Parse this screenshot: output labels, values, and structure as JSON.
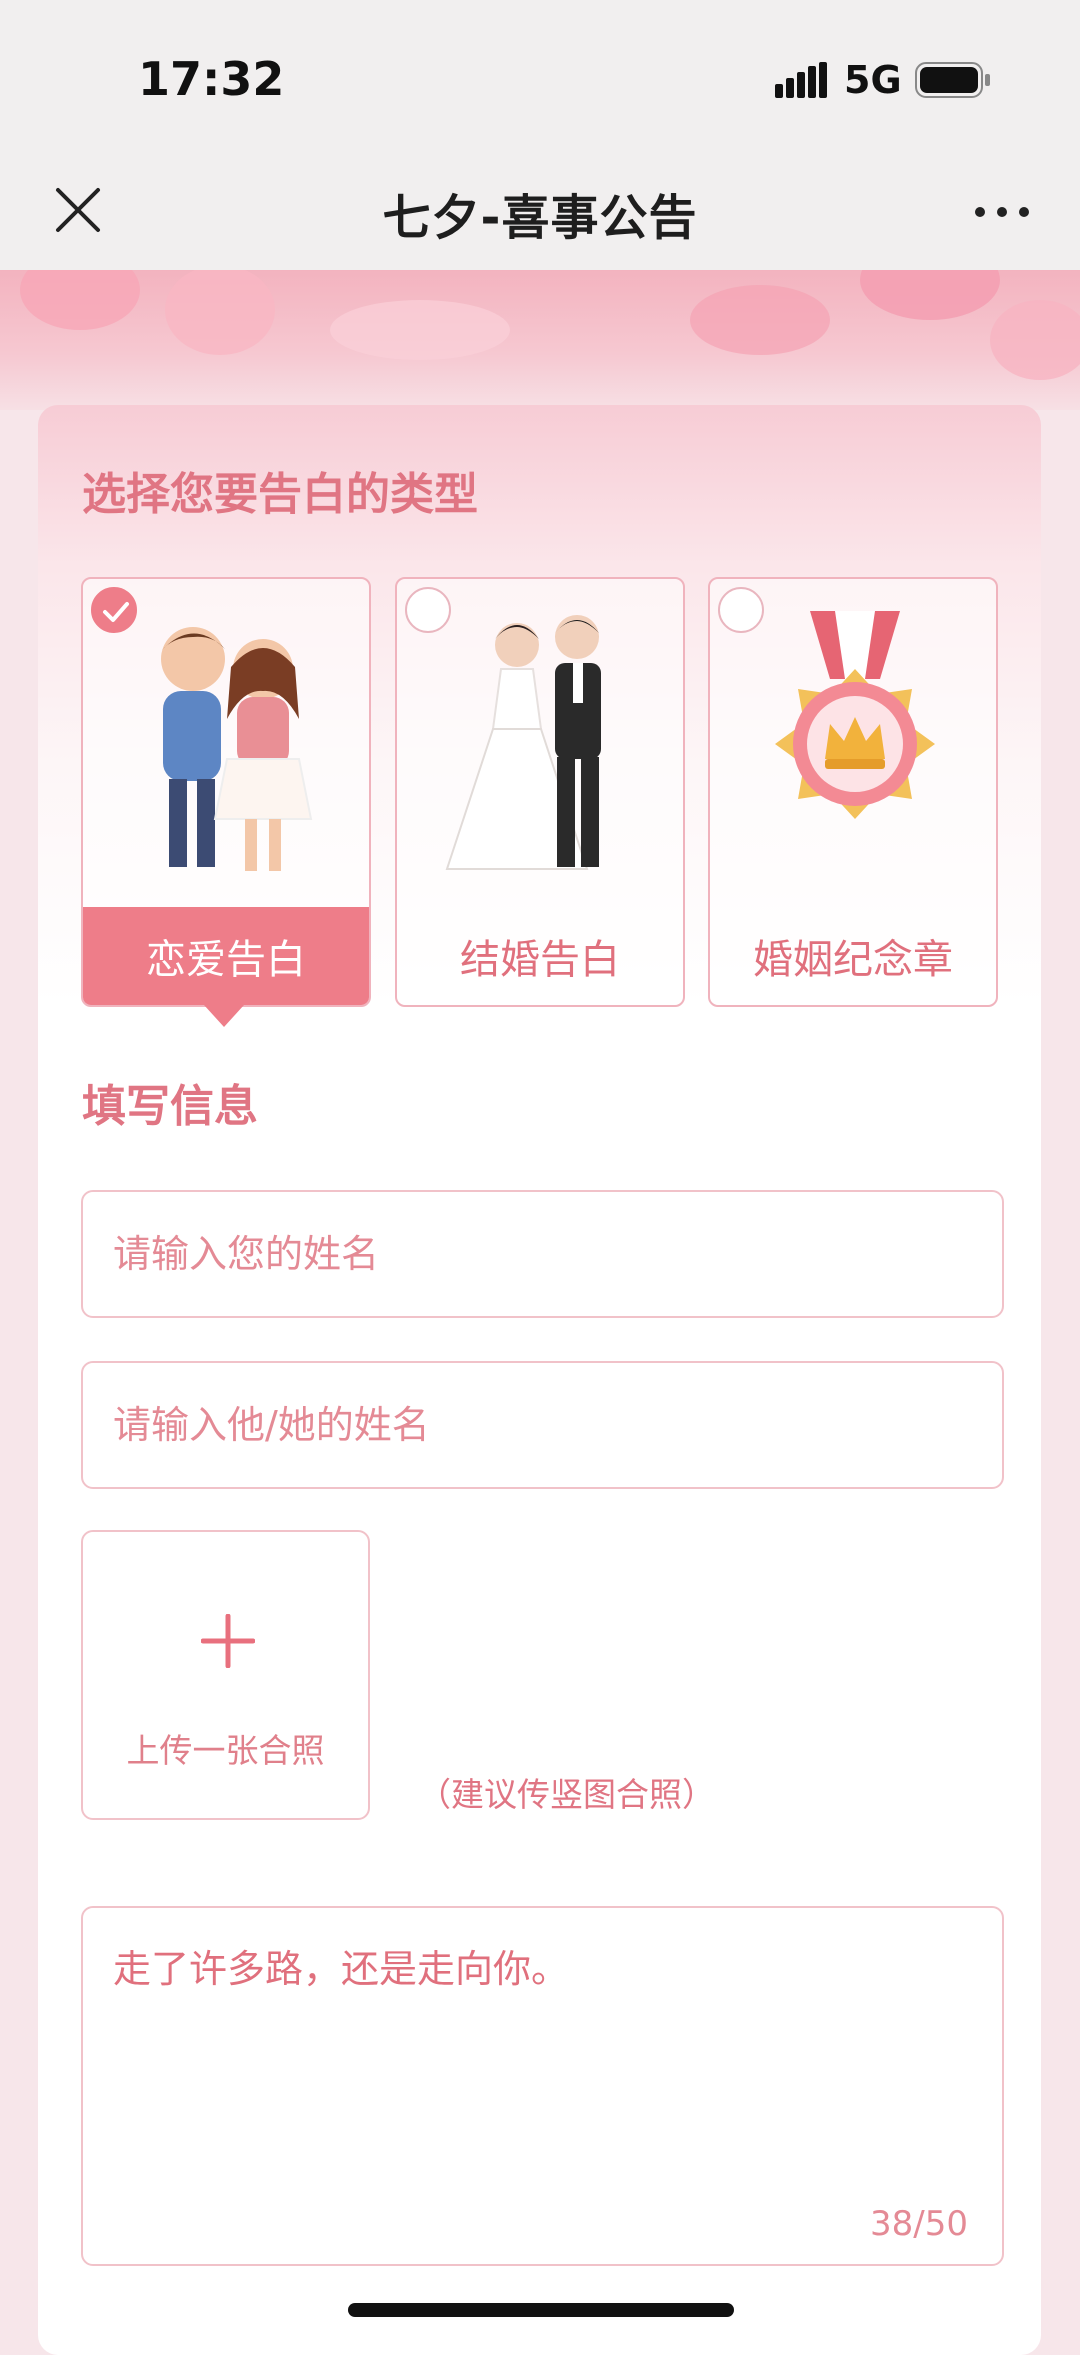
{
  "status_bar": {
    "time": "17:32",
    "network": "5G"
  },
  "nav": {
    "title": "七夕-喜事公告"
  },
  "choose_type": {
    "title": "选择您要告白的类型",
    "options": [
      {
        "label": "恋爱告白",
        "selected": true,
        "art": "couple-cartoon-icon"
      },
      {
        "label": "结婚告白",
        "selected": false,
        "art": "wedding-couple-icon"
      },
      {
        "label": "婚姻纪念章",
        "selected": false,
        "art": "medal-crown-icon"
      }
    ]
  },
  "fill_info": {
    "title": "填写信息",
    "your_name_placeholder": "请输入您的姓名",
    "partner_name_placeholder": "请输入他/她的姓名",
    "upload_label": "上传一张合照",
    "upload_hint": "（建议传竖图合照）",
    "message": "走了许多路，还是走向你。",
    "counter": "38/50"
  },
  "colors": {
    "accent": "#ee7d89",
    "text_pink": "#e0707d",
    "border": "#f1c2c9"
  }
}
